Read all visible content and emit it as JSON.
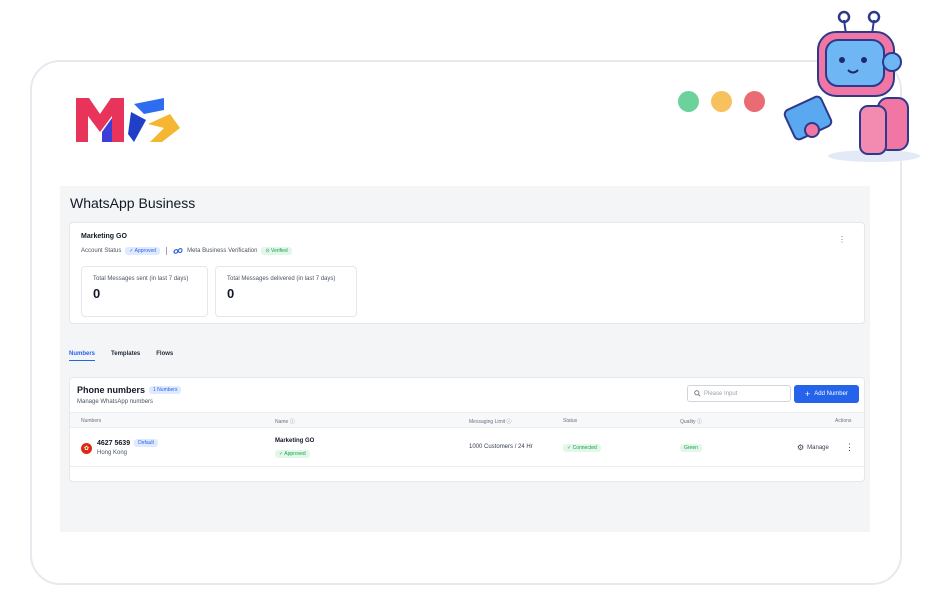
{
  "brand": {
    "logo_text": "MG"
  },
  "colors": {
    "dot1": "#6cd29b",
    "dot2": "#f7c15d",
    "dot3": "#ea6b73",
    "accent": "#2563eb",
    "robot_pink": "#f176a3",
    "robot_blue": "#5aa8f0"
  },
  "page": {
    "title": "WhatsApp Business"
  },
  "account": {
    "name": "Marketing GO",
    "status_label": "Account Status",
    "status_badge": "✓ Approved",
    "meta_label": "Meta Business Verification",
    "meta_badge": "⊙ Verified",
    "more_icon": "kebab-icon"
  },
  "stats": [
    {
      "label": "Total Messages sent (in last 7 days)",
      "value": "0"
    },
    {
      "label": "Total Messages delivered (in last 7 days)",
      "value": "0"
    }
  ],
  "tabs": [
    "Numbers",
    "Templates",
    "Flows"
  ],
  "phone_section": {
    "title": "Phone numbers",
    "count_badge": "1 Numbers",
    "subtitle": "Manage WhatsApp numbers",
    "search_placeholder": "Please Input",
    "add_button": "Add Number"
  },
  "table": {
    "headers": [
      "Numbers",
      "Name",
      "Messaging Limit",
      "Status",
      "Quality",
      "Actions"
    ],
    "rows": [
      {
        "number": "4627 5639",
        "default_badge": "Default",
        "region": "Hong Kong",
        "name": "Marketing GO",
        "name_badge": "✓ Approved",
        "limit": "1000 Customers / 24 Hr",
        "status": "✓ Connected",
        "quality": "Green",
        "action": "Manage"
      }
    ]
  }
}
